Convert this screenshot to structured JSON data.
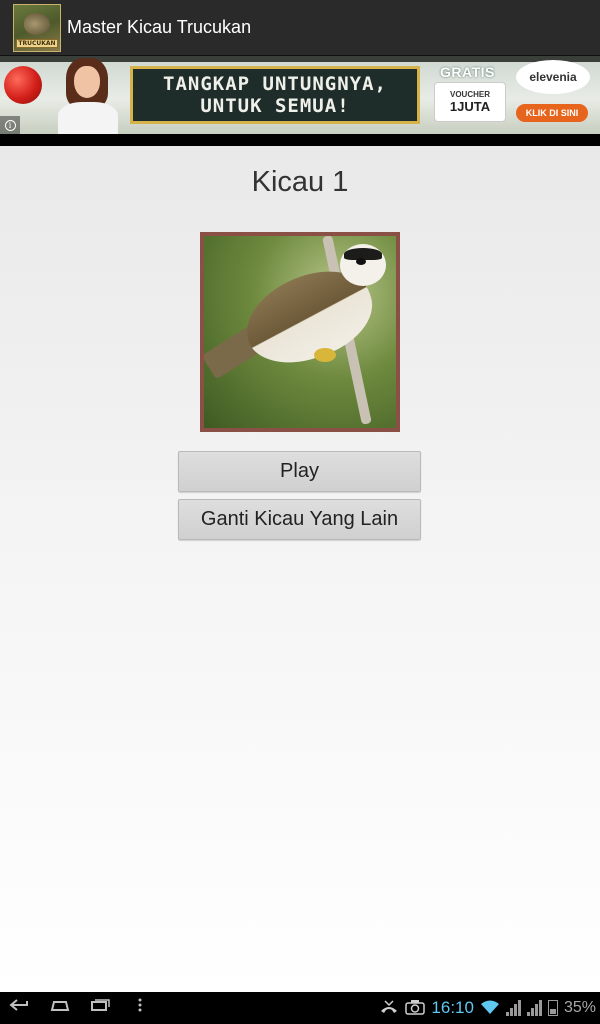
{
  "app_bar": {
    "title": "Master Kicau Trucukan",
    "icon_label": "TRUCUKAN"
  },
  "ad": {
    "headline_line1": "TANGKAP UNTUNGNYA,",
    "headline_line2": "UNTUK SEMUA!",
    "gratis": "GRATIS",
    "voucher_small": "VOUCHER",
    "voucher_big": "1JUTA",
    "brand": "elevenia",
    "cta": "KLIK DI SINI",
    "info_icon": "info-icon"
  },
  "main": {
    "title": "Kicau 1",
    "image_icon": "bird-photo",
    "play_label": "Play",
    "change_label": "Ganti Kicau Yang Lain"
  },
  "status_bar": {
    "time": "16:10",
    "battery_text": "35%"
  },
  "nav": {
    "back_icon": "back-icon",
    "home_icon": "home-icon",
    "recent_icon": "recent-apps-icon",
    "menu_icon": "menu-icon"
  },
  "colors": {
    "action_bar": "#2a2a2a",
    "frame": "#8a4f45",
    "time": "#5fc8f0"
  }
}
